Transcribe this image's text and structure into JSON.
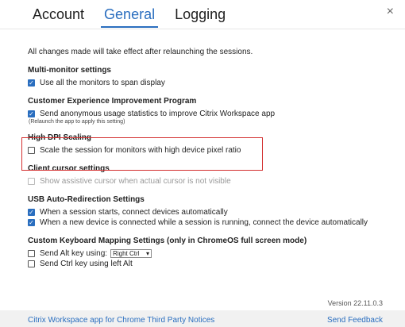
{
  "tabs": [
    {
      "label": "Account"
    },
    {
      "label": "General",
      "active": true
    },
    {
      "label": "Logging"
    }
  ],
  "close_label": "×",
  "general": {
    "note": "All changes made will take effect after relaunching the sessions.",
    "sections": {
      "multi_monitor": {
        "title": "Multi-monitor settings",
        "items": [
          {
            "label": "Use all the monitors to span display",
            "checked": true
          }
        ]
      },
      "ceip": {
        "title": "Customer Experience Improvement Program",
        "items": [
          {
            "label": "Send anonymous usage statistics to improve Citrix Workspace app",
            "checked": true
          }
        ],
        "subnote": "(Relaunch the app to apply this setting)"
      },
      "high_dpi": {
        "title": "High DPI Scaling",
        "items": [
          {
            "label": "Scale the session for monitors with high device pixel ratio",
            "checked": false
          }
        ]
      },
      "client_cursor": {
        "title": "Client cursor settings",
        "items": [
          {
            "label": "Show assistive cursor when actual cursor is not visible",
            "checked": false,
            "disabled": true
          }
        ]
      },
      "usb": {
        "title": "USB Auto-Redirection Settings",
        "items": [
          {
            "label": "When a session starts, connect devices automatically",
            "checked": true
          },
          {
            "label": "When a new device is connected while a session is running, connect the device automatically",
            "checked": true
          }
        ]
      },
      "keyboard": {
        "title": "Custom Keyboard Mapping Settings (only in ChromeOS full screen mode)",
        "items": [
          {
            "label": "Send Alt key using:",
            "checked": false
          },
          {
            "label": "Send Ctrl key using left Alt",
            "checked": false
          }
        ],
        "alt_key_select": {
          "selected": "Right Ctrl"
        }
      }
    }
  },
  "version": "Version 22.11.0.3",
  "footer": {
    "notices_link": "Citrix Workspace app for Chrome Third Party Notices",
    "feedback_link": "Send Feedback"
  },
  "colors": {
    "accent": "#2a6ebf",
    "highlight_border": "#d32f2f"
  }
}
